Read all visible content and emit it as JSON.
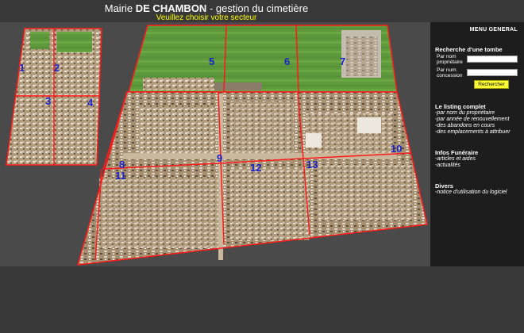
{
  "header": {
    "title_prefix": "Mairie ",
    "title_bold": "DE CHAMBON",
    "title_suffix": " - gestion du cimetière",
    "subtitle": "Veuillez choisir votre secteur"
  },
  "map": {
    "sectors": [
      "1",
      "2",
      "3",
      "4",
      "5",
      "6",
      "7",
      "8",
      "9",
      "10",
      "11",
      "12",
      "13"
    ],
    "border_color": "#ff1a1a",
    "label_color": "#1a22c8"
  },
  "sidebar": {
    "menu_title": "MENU GENERAL",
    "search": {
      "heading": "Recherche d'une tombe",
      "owner_label_1": "Par nom",
      "owner_label_2": "propriétaire",
      "owner_value": "",
      "concession_label_1": "Par num.",
      "concession_label_2": "concession",
      "concession_value": "",
      "button": "Rechercher"
    },
    "listing": {
      "heading": "Le listing complet",
      "links": [
        "-par nom du propriétaire",
        "-par année de renouvellement",
        "-des abandons en cours",
        "-des emplacements à attribuer"
      ]
    },
    "infos": {
      "heading": "Infos Funéraire",
      "links": [
        "-articles et aides",
        "-actualités"
      ]
    },
    "divers": {
      "heading": "Divers",
      "links": [
        "-notice d'utilisation du logiciel"
      ]
    }
  }
}
